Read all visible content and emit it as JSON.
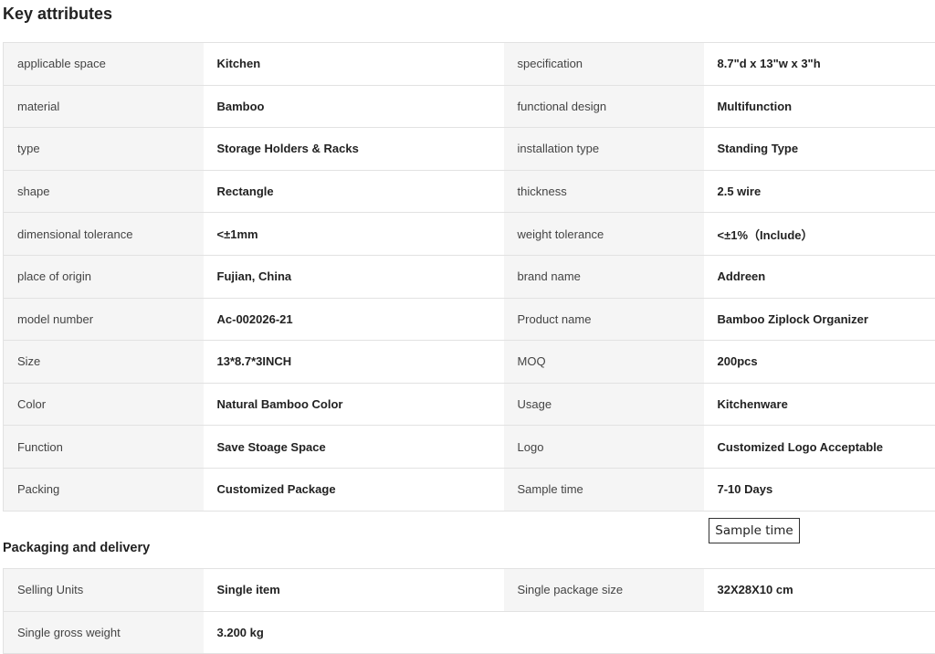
{
  "key_attributes": {
    "title": "Key attributes",
    "rows": [
      {
        "k1": "applicable space",
        "v1": "Kitchen",
        "k2": "specification",
        "v2": "8.7\"d x 13\"w x 3\"h"
      },
      {
        "k1": "material",
        "v1": "Bamboo",
        "k2": "functional design",
        "v2": "Multifunction"
      },
      {
        "k1": "type",
        "v1": "Storage Holders & Racks",
        "k2": "installation type",
        "v2": "Standing Type"
      },
      {
        "k1": "shape",
        "v1": "Rectangle",
        "k2": "thickness",
        "v2": "2.5 wire"
      },
      {
        "k1": "dimensional tolerance",
        "v1": "<±1mm",
        "k2": "weight tolerance",
        "v2": "<±1%（Include）"
      },
      {
        "k1": "place of origin",
        "v1": "Fujian, China",
        "k2": "brand name",
        "v2": "Addreen"
      },
      {
        "k1": "model number",
        "v1": "Ac-002026-21",
        "k2": "Product name",
        "v2": "Bamboo Ziplock Organizer"
      },
      {
        "k1": "Size",
        "v1": "13*8.7*3INCH",
        "k2": "MOQ",
        "v2": "200pcs"
      },
      {
        "k1": "Color",
        "v1": "Natural Bamboo Color",
        "k2": "Usage",
        "v2": "Kitchenware"
      },
      {
        "k1": "Function",
        "v1": "Save Stoage Space",
        "k2": "Logo",
        "v2": "Customized Logo Acceptable"
      },
      {
        "k1": "Packing",
        "v1": "Customized Package",
        "k2": "Sample time",
        "v2": "7-10 Days"
      }
    ]
  },
  "tooltip": {
    "text": "Sample time"
  },
  "packaging": {
    "title": "Packaging and delivery",
    "rows": [
      {
        "k1": "Selling Units",
        "v1": "Single item",
        "k2": "Single package size",
        "v2": "32X28X10 cm"
      },
      {
        "k1": "Single gross weight",
        "v1": "3.200 kg",
        "k2": "",
        "v2": ""
      }
    ]
  },
  "colors": {
    "key_cell_bg": "#f5f5f5",
    "value_cell_bg": "#ffffff",
    "border": "#e2e2e2",
    "text": "#222222"
  }
}
